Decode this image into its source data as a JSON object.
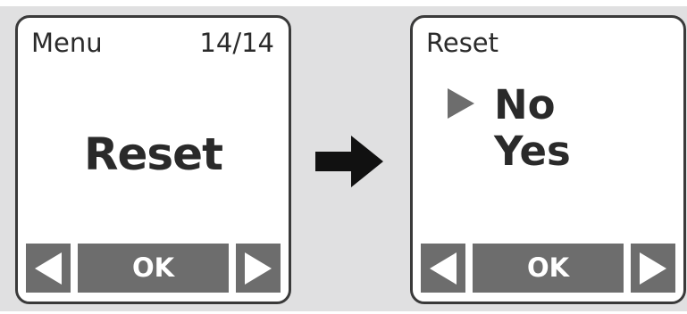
{
  "left_screen": {
    "header_title": "Menu",
    "header_count": "14/14",
    "main_title": "Reset",
    "softkeys": {
      "left_icon": "left-triangle-icon",
      "ok_label": "OK",
      "right_icon": "right-triangle-icon"
    }
  },
  "transition_icon": "right-arrow-icon",
  "right_screen": {
    "header_title": "Reset",
    "selection_indicator_icon": "selection-triangle-icon",
    "options": [
      "No",
      "Yes"
    ],
    "selected_option": "No",
    "softkeys": {
      "left_icon": "left-triangle-icon",
      "ok_label": "OK",
      "right_icon": "right-triangle-icon"
    }
  },
  "colors": {
    "background": "#e0e0e1",
    "screen": "#ffffff",
    "border": "#3a3a3a",
    "softkey": "#6d6d6d",
    "text": "#2a2a2a"
  }
}
